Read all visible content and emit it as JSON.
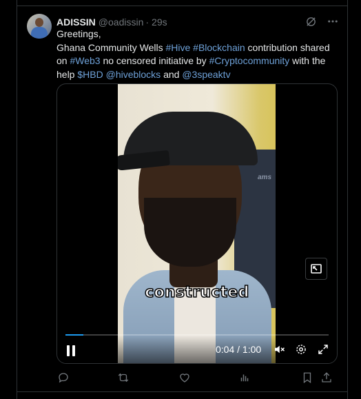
{
  "tweet": {
    "display_name": "ADISSIN",
    "handle": "@oadissin",
    "separator": "·",
    "time": "29s",
    "text_line1": "Greetings,",
    "text_line2_prefix": "Ghana Community Wells ",
    "tag_hive": "#Hive",
    "tag_blockchain": "#Blockchain",
    "text_line2_suffix": " contribution shared",
    "text_line3_prefix": "on ",
    "tag_web3": "#Web3",
    "text_line3_mid": " no censored initiative by ",
    "tag_crypto": "#Cryptocommunity",
    "text_line3_suffix": " with the",
    "text_line4_prefix": "help ",
    "cashtag_hbd": "$HBD",
    "mention_hiveblocks": "@hiveblocks",
    "text_and": " and ",
    "mention_3speak": "@3speaktv"
  },
  "video": {
    "caption": "constructed",
    "chair_text": "ams",
    "current_time": "0:04",
    "duration_separator": " / ",
    "duration": "1:00",
    "progress_fraction": 0.067
  },
  "icons": {
    "grok": "grok-icon",
    "more": "more-icon",
    "reply": "reply-icon",
    "retweet": "retweet-icon",
    "like": "like-icon",
    "views": "views-icon",
    "bookmark": "bookmark-icon",
    "share": "share-icon"
  },
  "colors": {
    "link": "#6ea1d8",
    "border": "#2f3336",
    "muted": "#71767b",
    "progress": "#1d9bf0"
  }
}
